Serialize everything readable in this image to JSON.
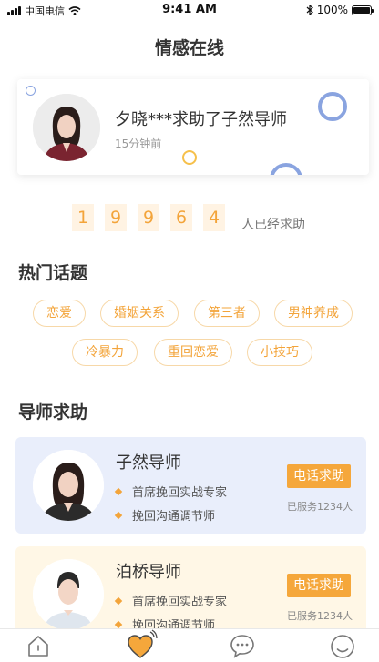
{
  "status_bar": {
    "carrier": "中国电信",
    "time": "9:41 AM",
    "battery": "100%",
    "battery_level": 1.0
  },
  "header": {
    "title": "情感在线"
  },
  "notice": {
    "text": "夕晓***求助了子然导师",
    "time": "15分钟前"
  },
  "counter": {
    "digits": [
      "1",
      "9",
      "9",
      "6",
      "4"
    ],
    "label": "人已经求助"
  },
  "topics": {
    "title": "热门话题",
    "tags": [
      "恋爱",
      "婚姻关系",
      "第三者",
      "男神养成",
      "冷暴力",
      "重回恋爱",
      "小技巧"
    ]
  },
  "mentors": {
    "title": "导师求助",
    "items": [
      {
        "name": "子然导师",
        "tags": [
          "首席挽回实战专家",
          "挽回沟通调节师"
        ],
        "button": "电话求助",
        "served": "已服务1234人",
        "bg": "#e9eefb"
      },
      {
        "name": "泊桥导师",
        "tags": [
          "首席挽回实战专家",
          "挽回沟通调节师"
        ],
        "button": "电话求助",
        "served": "已服务1234人",
        "bg": "#fff7e6"
      }
    ]
  },
  "tabbar": {
    "icons": [
      "home-icon",
      "heart-call-icon",
      "chat-icon",
      "smile-icon"
    ]
  },
  "colors": {
    "accent": "#f3a43a",
    "accent_light": "#fff3e3",
    "tag_border": "#f7d8a8",
    "deco_blue": "#8aa4e0",
    "deco_yellow": "#f6c04b"
  }
}
